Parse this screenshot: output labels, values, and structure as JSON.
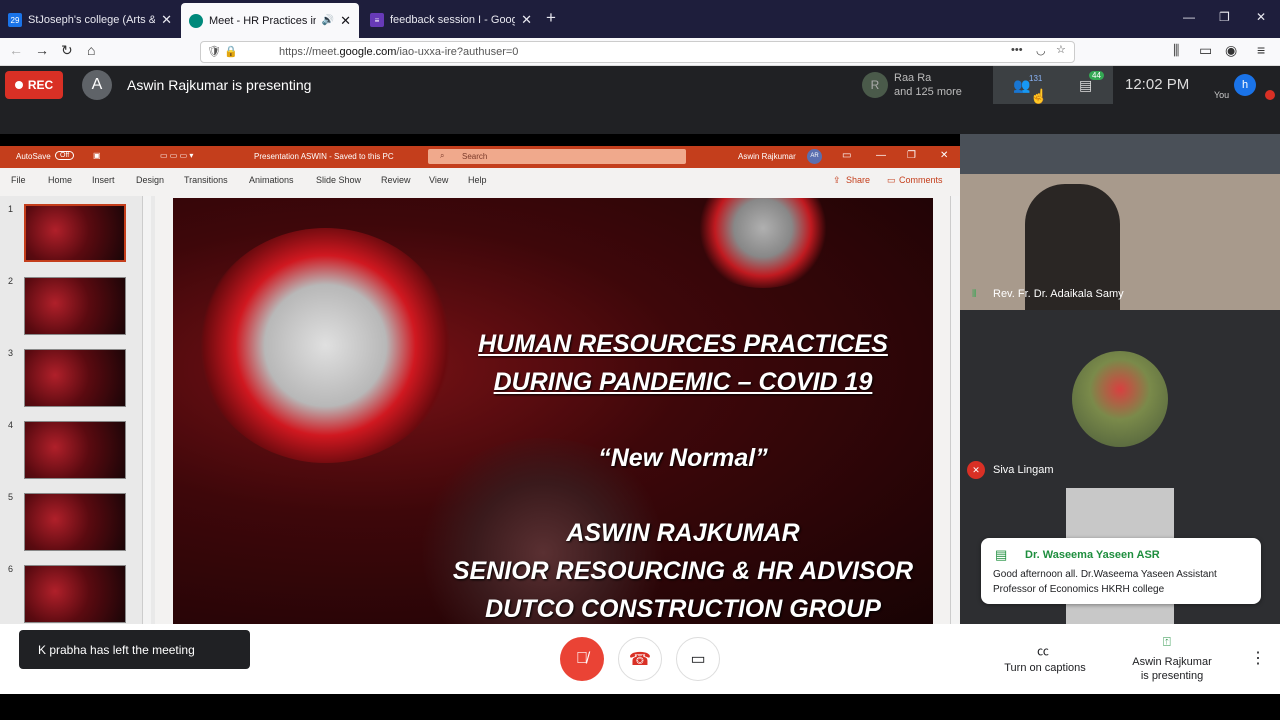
{
  "browser": {
    "tabs": [
      {
        "label": "StJoseph's college (Arts & Scie",
        "active": false
      },
      {
        "label": "Meet - HR Practices inPand",
        "active": true
      },
      {
        "label": "feedback session I - Google Fo",
        "active": false
      }
    ],
    "url_prefix": "https://meet.",
    "url_domain": "google.com",
    "url_rest": "/iao-uxxa-ire?authuser=0"
  },
  "meet": {
    "rec_label": "REC",
    "presenter_initial": "A",
    "presenter_title": "Aswin Rajkumar is presenting",
    "participant_initial": "R",
    "participant_name": "Raa Ra",
    "participant_more": "and 125 more",
    "people_count": "131",
    "chat_count": "44",
    "time": "12:02 PM",
    "you_label": "You",
    "you_initial": "h"
  },
  "ppt": {
    "autosave_label": "AutoSave",
    "autosave_state": "Off",
    "doc_title": "Presentation ASWIN  -  Saved to this PC",
    "search_placeholder": "Search",
    "user_name": "Aswin Rajkumar",
    "user_initials": "AR",
    "menu": [
      "File",
      "Home",
      "Insert",
      "Design",
      "Transitions",
      "Animations",
      "Slide Show",
      "Review",
      "View",
      "Help"
    ],
    "share_label": "Share",
    "comments_label": "Comments",
    "slide_numbers": [
      "1",
      "2",
      "3",
      "4",
      "5",
      "6"
    ],
    "slide": {
      "line1": "HUMAN RESOURCES PRACTICES",
      "line2": "DURING PANDEMIC – COVID 19",
      "line3": "“New Normal”",
      "line4": "ASWIN RAJKUMAR",
      "line5": "SENIOR RESOURCING & HR ADVISOR",
      "line6": "DUTCO CONSTRUCTION GROUP"
    }
  },
  "tiles": {
    "tile1_name": "Rev. Fr. Dr. Adaikala Samy",
    "tile2_name": "Siva Lingam"
  },
  "chat_popup": {
    "sender": "Dr. Waseema Yaseen ASR",
    "message": "Good afternoon all. Dr.Waseema Yaseen Assistant Professor of Economics HKRH college"
  },
  "toast": "K prabha has left the meeting",
  "bottom": {
    "captions_label": "Turn on captions",
    "presenting_line1": "Aswin Rajkumar",
    "presenting_line2": "is presenting"
  },
  "colors": {
    "rec": "#d93025",
    "mic_off": "#ea4335",
    "ppt_title": "#c43e1c",
    "meet_dark": "#202124",
    "tab_bar": "#1e1e3c"
  }
}
